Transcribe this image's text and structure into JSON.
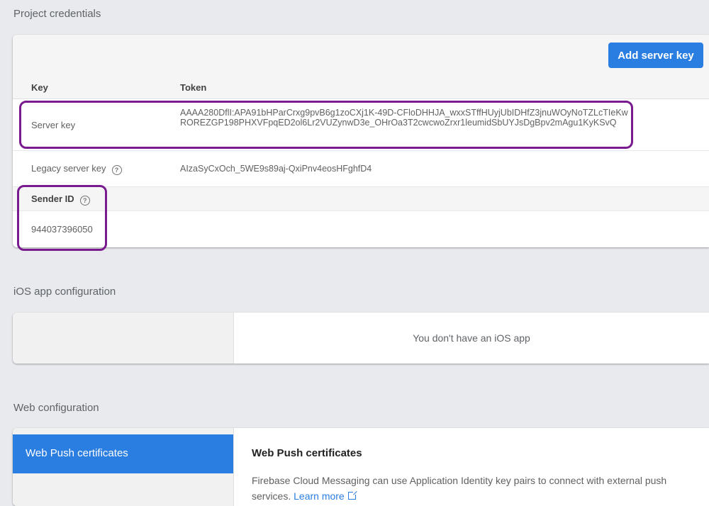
{
  "credentials": {
    "section_title": "Project credentials",
    "add_button": "Add server key",
    "columns": {
      "key": "Key",
      "token": "Token"
    },
    "server_key": {
      "label": "Server key",
      "token": "AAAA280DflI:APA91bHParCrxg9pvB6g1zoCXj1K-49D-CFloDHHJA_wxxSTffHUyjUbIDHfZ3jnuWOyNoTZLcTIeKwROREZGP198PHXVFpqED2ol6Lr2VUZynwD3e_OHrOa3T2cwcwoZrxr1leumidSbUYJsDgBpv2mAgu1KyKSvQ"
    },
    "legacy_key": {
      "label": "Legacy server key",
      "token": "AIzaSyCxOch_5WE9s89aj-QxiPnv4eosHFghfD4"
    },
    "sender_id": {
      "label": "Sender ID",
      "value": "944037396050"
    },
    "help_glyph": "?"
  },
  "ios": {
    "section_title": "iOS app configuration",
    "empty_message": "You don't have an iOS app"
  },
  "web": {
    "section_title": "Web configuration",
    "tab_label": "Web Push certificates",
    "heading": "Web Push certificates",
    "description": "Firebase Cloud Messaging can use Application Identity key pairs to connect with external push services.",
    "learn_more": "Learn more"
  },
  "colors": {
    "accent": "#2a7de1",
    "highlight": "#7a1a8f",
    "background": "#e8eaed"
  }
}
